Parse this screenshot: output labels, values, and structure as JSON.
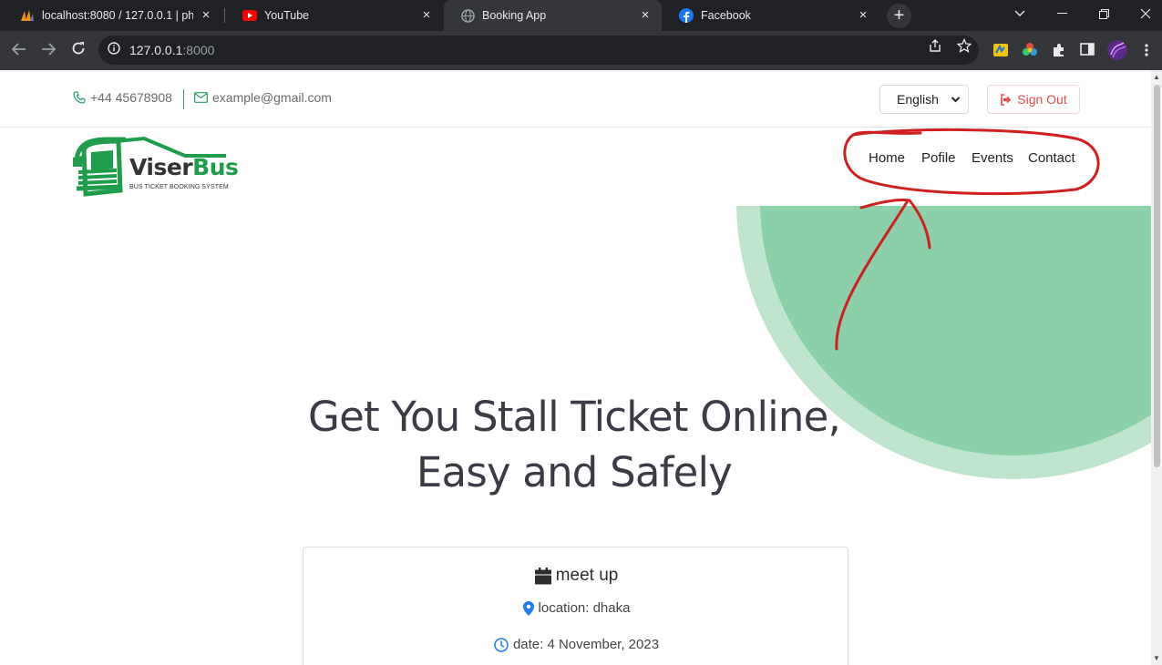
{
  "browser": {
    "tabs": [
      {
        "title": "localhost:8080 / 127.0.0.1 | phpMyAdmin",
        "icon": "phpmyadmin-icon",
        "active": false
      },
      {
        "title": "YouTube",
        "icon": "youtube-icon",
        "active": false
      },
      {
        "title": "Booking App",
        "icon": "globe-icon",
        "active": true
      },
      {
        "title": "Facebook",
        "icon": "facebook-icon",
        "active": false
      }
    ],
    "url_host": "127.0.0.1",
    "url_port": ":8000"
  },
  "topbar": {
    "phone": "+44 45678908",
    "email": "example@gmail.com",
    "language": "English",
    "signout_label": "Sign Out"
  },
  "logo": {
    "name_a": "Viser",
    "name_b": "Bus",
    "tagline": "BUS TICKET BOOKING SYSTEM"
  },
  "nav": {
    "items": [
      {
        "label": "Home"
      },
      {
        "label": "Pofile"
      },
      {
        "label": "Events"
      },
      {
        "label": "Contact"
      }
    ]
  },
  "hero": {
    "title_line1": "Get You Stall Ticket Online,",
    "title_line2": "Easy and Safely"
  },
  "event_card": {
    "title": "meet up",
    "location": "location: dhaka",
    "date": "date: 4 November, 2023"
  },
  "colors": {
    "brand_green": "#1f9d4a",
    "circle_inner": "#8bd0a8",
    "circle_outer": "#bfe5cf",
    "signout_red": "#e94949",
    "annotation_red": "#d01f1f"
  }
}
